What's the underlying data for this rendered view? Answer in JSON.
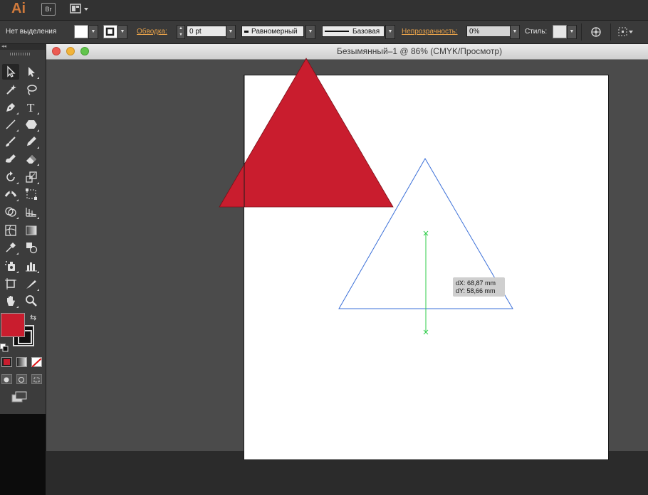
{
  "app": {
    "logo": "Ai",
    "bridge": "Br",
    "workspace_icon": "layout-icon"
  },
  "control_bar": {
    "selection_label": "Нет выделения",
    "stroke_label": "Обводка:",
    "stroke_value": "0 pt",
    "profile_value": "Равномерный",
    "brush_value": "Базовая",
    "opacity_label": "Непрозрачность:",
    "opacity_value": "0%",
    "style_label": "Стиль:"
  },
  "document": {
    "title": "Безымянный–1 @ 86% (CMYK/Просмотр)"
  },
  "colors": {
    "fill": "#c91d2e",
    "selection": "#3a6fd8",
    "guide": "#2fcc4a"
  },
  "tooltip": {
    "dx": "dX: 68,87 mm",
    "dy": "dY: 58,66 mm"
  }
}
